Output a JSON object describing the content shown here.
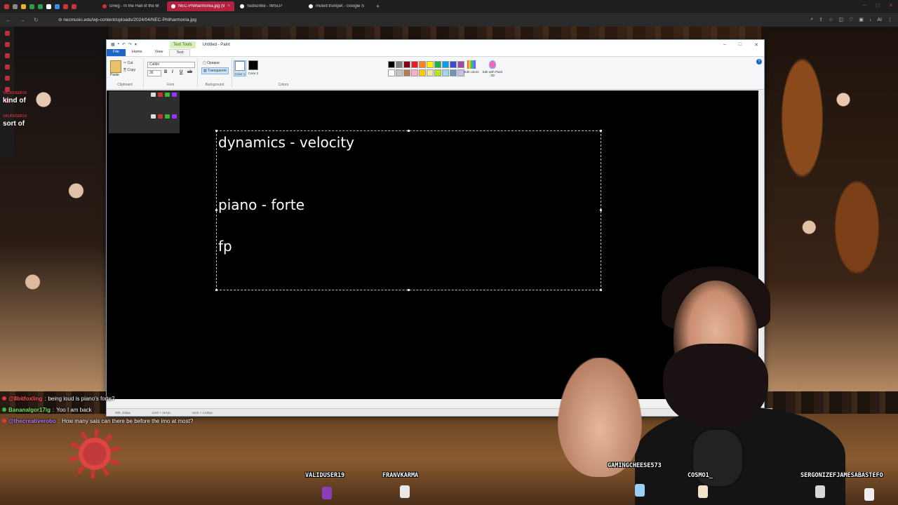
{
  "browser": {
    "tabs": [
      {
        "label": "Grieg - In the Hall of the M",
        "active": false
      },
      {
        "label": "NEC-Philharmonia.jpg (9",
        "active": true
      },
      {
        "label": "Subscribe - IMSLP",
        "active": false
      },
      {
        "label": "muted trumpet - Google S",
        "active": false
      }
    ],
    "url": "necmusic.edu/wp-content/uploads/2024/04/NEC-Philharmonia.jpg",
    "extension_label": "AI"
  },
  "paint": {
    "window_title": "Untitled - Paint",
    "contextual_tab": "Text Tools",
    "ribbon_tabs": {
      "file": "File",
      "home": "Home",
      "view": "View",
      "text": "Text"
    },
    "clipboard": {
      "paste": "Paste",
      "cut": "Cut",
      "copy": "Copy",
      "group": "Clipboard"
    },
    "font": {
      "family": "Calibri",
      "size": "36",
      "group": "Font"
    },
    "background": {
      "opaque": "Opaque",
      "transparent": "Transparent",
      "group": "Background"
    },
    "colors": {
      "color1_label": "Color 1",
      "color2_label": "Color 2",
      "group": "Colors",
      "color1": "#ffffff",
      "color2": "#000000",
      "edit_colors": "Edit colors",
      "edit_3d": "Edit with Paint 3D",
      "palette": [
        "#000000",
        "#7f7f7f",
        "#880015",
        "#ed1c24",
        "#ff7f27",
        "#fff200",
        "#22b14c",
        "#00a2e8",
        "#3f48cc",
        "#a349a4",
        "#ffffff",
        "#c3c3c3",
        "#b97a57",
        "#ffaec9",
        "#ffc90e",
        "#efe4b0",
        "#b5e61d",
        "#99d9ea",
        "#7092be",
        "#c8bfe7"
      ]
    },
    "canvas_text": {
      "line1": "dynamics - velocity",
      "line2": "piano - forte",
      "line3": "fp"
    },
    "status": {
      "cursor": "309, 326px",
      "selection": "1100 × 457px",
      "size": "4442 × 1238px"
    }
  },
  "chat_overlay_left": [
    {
      "user": "VALIDUSER19",
      "message": "kind of"
    },
    {
      "user": "VALIDUSER19",
      "message": "sort of"
    }
  ],
  "chat_log": [
    {
      "user": "@8bitfoxling",
      "color": "#ff5252",
      "badge": "#e03a3a",
      "message": "being loud is piano's forte?"
    },
    {
      "user": "Bananalgor17ig",
      "color": "#7ce85a",
      "badge": "#3bb54a",
      "message": "Yoo I am back"
    },
    {
      "user": "@thecreativerobo",
      "color": "#b77dff",
      "badge": "#e03a3a",
      "message": "How many sais can there be before the imo at most?"
    }
  ],
  "viewers": [
    "VALIDUSER19",
    "FRANVKARMA",
    "GAMINGCHEESE573",
    "COSMO1_",
    "SERGONIZEFJAMESABASTEFO"
  ]
}
